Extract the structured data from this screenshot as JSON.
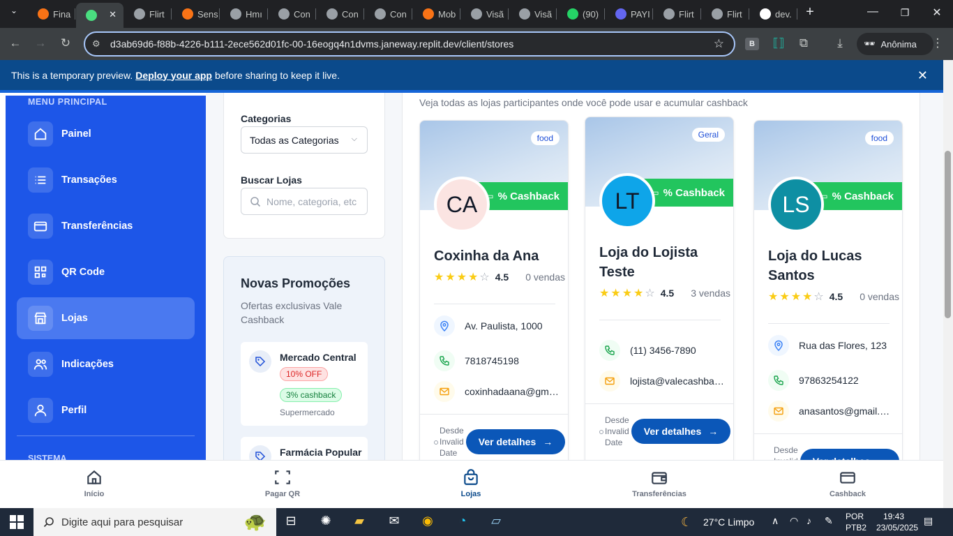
{
  "browser": {
    "tabs": [
      {
        "label": "Fina",
        "color": "#f97316"
      },
      {
        "label": "",
        "color": "#4ade80"
      },
      {
        "label": "Flirt",
        "color": "#9aa0a6"
      },
      {
        "label": "Sens",
        "color": "#f97316"
      },
      {
        "label": "Hmı",
        "color": "#9aa0a6"
      },
      {
        "label": "Con",
        "color": "#9aa0a6"
      },
      {
        "label": "Con",
        "color": "#9aa0a6"
      },
      {
        "label": "Con",
        "color": "#9aa0a6"
      },
      {
        "label": "Mob",
        "color": "#f97316"
      },
      {
        "label": "Visã",
        "color": "#9aa0a6"
      },
      {
        "label": "Visã",
        "color": "#9aa0a6"
      },
      {
        "label": "(90)",
        "color": "#25d366"
      },
      {
        "label": "PAYI",
        "color": "#6366f1"
      },
      {
        "label": "Flirt",
        "color": "#9aa0a6"
      },
      {
        "label": "Flirt",
        "color": "#9aa0a6"
      },
      {
        "label": "dev.",
        "color": "#ffffff"
      }
    ],
    "new_tab": "+",
    "url": "d3ab69d6-f88b-4226-b111-2ece562d01fc-00-16eogq4n1dvms.janeway.replit.dev/client/stores",
    "profile_label": "Anônima",
    "ext_b": "B"
  },
  "banner": {
    "text_before": "This is a temporary preview.",
    "link": "Deploy your app",
    "text_after": "before sharing to keep it live."
  },
  "sidebar": {
    "header": "MENU PRINCIPAL",
    "items": [
      {
        "label": "Painel",
        "icon": "home-icon"
      },
      {
        "label": "Transações",
        "icon": "list-icon"
      },
      {
        "label": "Transferências",
        "icon": "card-icon"
      },
      {
        "label": "QR Code",
        "icon": "qr-icon"
      },
      {
        "label": "Lojas",
        "icon": "store-icon",
        "active": true
      },
      {
        "label": "Indicações",
        "icon": "users-icon"
      },
      {
        "label": "Perfil",
        "icon": "user-icon"
      }
    ],
    "system_header": "SISTEMA"
  },
  "filters": {
    "categories_label": "Categorias",
    "categories_value": "Todas as Categorias",
    "search_label": "Buscar Lojas",
    "search_placeholder": "Nome, categoria, etc"
  },
  "promos": {
    "title": "Novas Promoções",
    "subtitle": "Ofertas exclusivas Vale Cashback",
    "items": [
      {
        "name": "Mercado Central",
        "discount": "10% OFF",
        "cashback": "3% cashback",
        "category": "Supermercado"
      },
      {
        "name": "Farmácia Popular"
      }
    ]
  },
  "stores": {
    "intro": "Veja todas as lojas participantes onde você pode usar e acumular cashback",
    "cashback_label": "% Cashback",
    "details_label": "Ver detalhes",
    "since_label": "Desde Invalid Date",
    "items": [
      {
        "category": "food",
        "initials": "CA",
        "avatar_bg": "#fbe4e2",
        "avatar_color": "#111827",
        "name": "Coxinha da Ana",
        "rating": "4.5",
        "sales": "0 vendas",
        "address": "Av. Paulista, 1000",
        "phone": "7818745198",
        "email": "coxinhadaana@gmail.com"
      },
      {
        "category": "Geral",
        "initials": "LT",
        "avatar_bg": "#0ea5e9",
        "avatar_color": "#111827",
        "name": "Loja do Lojista Teste",
        "rating": "4.5",
        "sales": "3 vendas",
        "phone": "(11) 3456-7890",
        "email": "lojista@valecashback.com"
      },
      {
        "category": "food",
        "initials": "LS",
        "avatar_bg": "#0e8fa3",
        "avatar_color": "#ffffff",
        "name": "Loja do Lucas Santos",
        "rating": "4.5",
        "sales": "0 vendas",
        "address": "Rua das Flores, 123",
        "phone": "97863254122",
        "email": "anasantos@gmail.com"
      }
    ]
  },
  "bottom_nav": [
    {
      "label": "Início",
      "icon": "home-icon"
    },
    {
      "label": "Pagar QR",
      "icon": "scan-icon"
    },
    {
      "label": "Lojas",
      "icon": "bag-icon",
      "active": true
    },
    {
      "label": "Transferências",
      "icon": "wallet-icon"
    },
    {
      "label": "Cashback",
      "icon": "card-icon"
    }
  ],
  "taskbar": {
    "search_placeholder": "Digite aqui para pesquisar",
    "weather": "27°C  Limpo",
    "lang1": "POR",
    "lang2": "PTB2",
    "time": "19:43",
    "date": "23/05/2025"
  }
}
